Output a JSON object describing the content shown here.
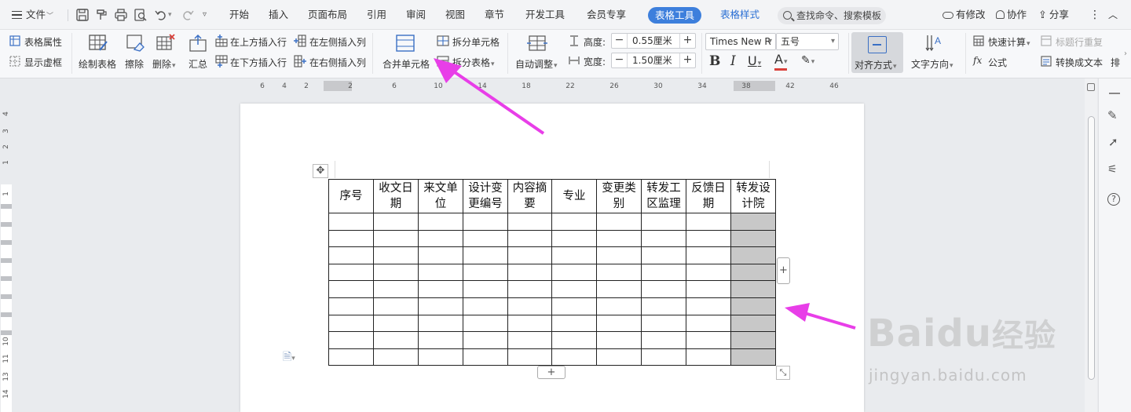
{
  "menubar": {
    "file": "文件",
    "tabs": [
      "开始",
      "插入",
      "页面布局",
      "引用",
      "审阅",
      "视图",
      "章节",
      "开发工具",
      "会员专享"
    ],
    "active_tab": "表格工具",
    "style_tab": "表格样式",
    "search_placeholder": "查找命令、搜索模板",
    "has_changes": "有修改",
    "collaborate": "协作",
    "share": "分享"
  },
  "ribbon": {
    "table_props": "表格属性",
    "show_gridlines": "显示虚框",
    "draw_table": "绘制表格",
    "erase": "擦除",
    "delete": "删除",
    "summary": "汇总",
    "insert_above": "在上方插入行",
    "insert_below": "在下方插入行",
    "insert_left": "在左侧插入列",
    "insert_right": "在右侧插入列",
    "merge_cells": "合并单元格",
    "split_cells": "拆分单元格",
    "split_table": "拆分表格",
    "auto_fit": "自动调整",
    "height_label": "高度:",
    "height_value": "0.55厘米",
    "width_label": "宽度:",
    "width_value": "1.50厘米",
    "font_name": "Times New R",
    "font_size": "五号",
    "align": "对齐方式",
    "text_dir": "文字方向",
    "quick_calc": "快速计算",
    "header_repeat": "标题行重复",
    "formula": "公式",
    "to_text": "转换成文本",
    "more": "排"
  },
  "hruler": {
    "labels": [
      "6",
      "4",
      "2",
      "2",
      "6",
      "10",
      "14",
      "18",
      "22",
      "26",
      "30",
      "34",
      "38",
      "42",
      "46"
    ]
  },
  "vruler": {
    "labels": [
      "4",
      "3",
      "2",
      "1",
      "1",
      "10",
      "11",
      "13",
      "14"
    ]
  },
  "table": {
    "headers": [
      [
        "序号"
      ],
      [
        "收文日",
        "期"
      ],
      [
        "来文单",
        "位"
      ],
      [
        "设计变",
        "更编号"
      ],
      [
        "内容摘",
        "要"
      ],
      [
        "专业"
      ],
      [
        "变更类",
        "别"
      ],
      [
        "转发工",
        "区监理"
      ],
      [
        "反馈日",
        "期"
      ],
      [
        "转发设",
        "计院"
      ]
    ],
    "empty_rows": 9,
    "selected_column_index": 9
  },
  "colors": {
    "accent": "#3d7fdc",
    "arrow": "#e83ee8",
    "selected_cell": "#c8c8c8"
  },
  "watermark": {
    "brand": "Baidu",
    "brand_cn": "经验",
    "url": "jingyan.baidu.com"
  }
}
